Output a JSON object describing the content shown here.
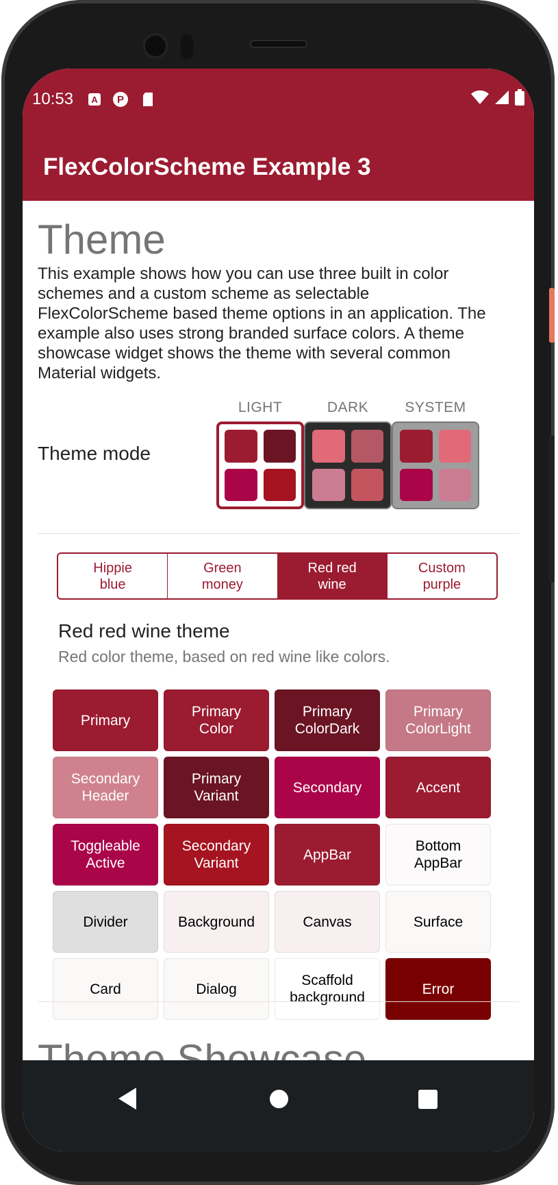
{
  "status_bar": {
    "time": "10:53",
    "icons_left": [
      "A",
      "P",
      "sd-card-icon"
    ],
    "icons_right": [
      "wifi-icon",
      "signal-icon",
      "battery-icon"
    ]
  },
  "app_bar": {
    "title": "FlexColorScheme Example 3",
    "color": "#9b1b30"
  },
  "theme_section": {
    "heading": "Theme",
    "description": "This example shows how you can use three built in color schemes and a custom scheme as selectable FlexColorScheme based theme options in an application. The example also uses strong branded surface colors. A theme showcase widget shows the theme with several common Material widgets.",
    "theme_mode_label": "Theme mode",
    "modes": [
      {
        "caption": "LIGHT",
        "selected": true,
        "background": "#ffffff",
        "colors": [
          "#9b1b30",
          "#6b1423",
          "#ab0549",
          "#a51420"
        ]
      },
      {
        "caption": "DARK",
        "selected": false,
        "background": "#2b2b2b",
        "colors": [
          "#e16a79",
          "#b45865",
          "#cc7c92",
          "#c4545d"
        ]
      },
      {
        "caption": "SYSTEM",
        "selected": false,
        "background": "#9e9e9e",
        "colors": [
          "#9b1b30",
          "#e16a79",
          "#ab0549",
          "#cc7c92"
        ]
      }
    ]
  },
  "scheme_toggles": [
    {
      "label_line1": "Hippie",
      "label_line2": "blue",
      "selected": false
    },
    {
      "label_line1": "Green",
      "label_line2": "money",
      "selected": false
    },
    {
      "label_line1": "Red red",
      "label_line2": "wine",
      "selected": true
    },
    {
      "label_line1": "Custom",
      "label_line2": "purple",
      "selected": false
    }
  ],
  "scheme": {
    "name": "Red red wine theme",
    "description": "Red color theme, based on red wine like colors."
  },
  "color_cells": [
    {
      "label": "Primary",
      "bg": "#9b1b30",
      "fg": "#ffffff"
    },
    {
      "label": "Primary\nColor",
      "bg": "#9b1b30",
      "fg": "#ffffff"
    },
    {
      "label": "Primary\nColorDark",
      "bg": "#6b1423",
      "fg": "#ffffff"
    },
    {
      "label": "Primary\nColorLight",
      "bg": "#c57886",
      "fg": "#ffffff"
    },
    {
      "label": "Secondary\nHeader",
      "bg": "#cf828e",
      "fg": "#ffffff"
    },
    {
      "label": "Primary\nVariant",
      "bg": "#6b1423",
      "fg": "#ffffff"
    },
    {
      "label": "Secondary",
      "bg": "#ab0549",
      "fg": "#ffffff"
    },
    {
      "label": "Accent",
      "bg": "#9b1b30",
      "fg": "#ffffff"
    },
    {
      "label": "Toggleable\nActive",
      "bg": "#ab0549",
      "fg": "#ffffff"
    },
    {
      "label": "Secondary\nVariant",
      "bg": "#a51420",
      "fg": "#ffffff"
    },
    {
      "label": "AppBar",
      "bg": "#9b1b30",
      "fg": "#ffffff"
    },
    {
      "label": "Bottom\nAppBar",
      "bg": "#fcfafa",
      "fg": "#000000"
    },
    {
      "label": "Divider",
      "bg": "#dfdfdf",
      "fg": "#000000"
    },
    {
      "label": "Background",
      "bg": "#f8eff0",
      "fg": "#000000"
    },
    {
      "label": "Canvas",
      "bg": "#f8eff0",
      "fg": "#000000"
    },
    {
      "label": "Surface",
      "bg": "#fbf8f8",
      "fg": "#000000"
    },
    {
      "label": "Card",
      "bg": "#fbf8f8",
      "fg": "#000000"
    },
    {
      "label": "Dialog",
      "bg": "#fbf8f8",
      "fg": "#000000"
    },
    {
      "label": "Scaffold\nbackground",
      "bg": "#ffffff",
      "fg": "#000000"
    },
    {
      "label": "Error",
      "bg": "#790000",
      "fg": "#ffffff"
    }
  ],
  "showcase_heading": "Theme Showcase",
  "nav": {
    "back": "back-icon",
    "home": "home-icon",
    "recents": "recents-icon"
  }
}
